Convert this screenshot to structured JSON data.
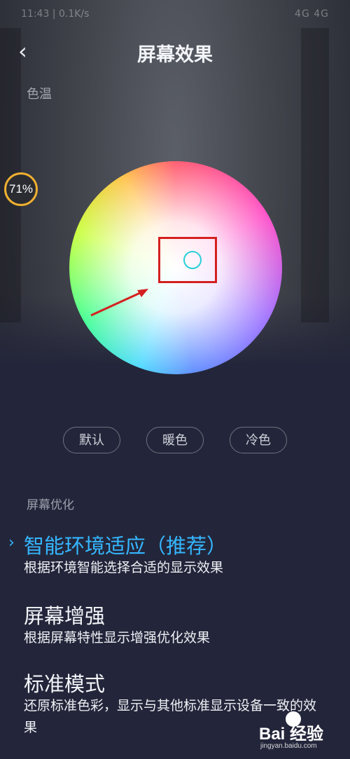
{
  "status_bar": {
    "time": "11:43 | 0.1K/s",
    "network": "4G 4G"
  },
  "header": {
    "back_glyph": "‹",
    "title": "屏幕效果"
  },
  "color_temp": {
    "section_label": "色温",
    "badge": "71%",
    "presets": [
      {
        "label": "默认"
      },
      {
        "label": "暖色"
      },
      {
        "label": "冷色"
      }
    ]
  },
  "optimization": {
    "section_label": "屏幕优化",
    "selected_mark": "›",
    "items": [
      {
        "title": "智能环境适应（推荐）",
        "desc": "根据环境智能选择合适的显示效果",
        "selected": true
      },
      {
        "title": "屏幕增强",
        "desc": "根据屏幕特性显示增强优化效果",
        "selected": false
      },
      {
        "title": "标准模式",
        "desc": "还原标准色彩，显示与其他标准显示设备一致的效果",
        "selected": false
      }
    ]
  },
  "watermark": {
    "logo_text": "Bai 经验",
    "sub_text": "jingyan.baidu.com"
  },
  "colors": {
    "accent": "#35b6ff",
    "picker_ring": "#2ad0d8",
    "annotation": "#d42020",
    "badge_ring": "#f0b030"
  }
}
